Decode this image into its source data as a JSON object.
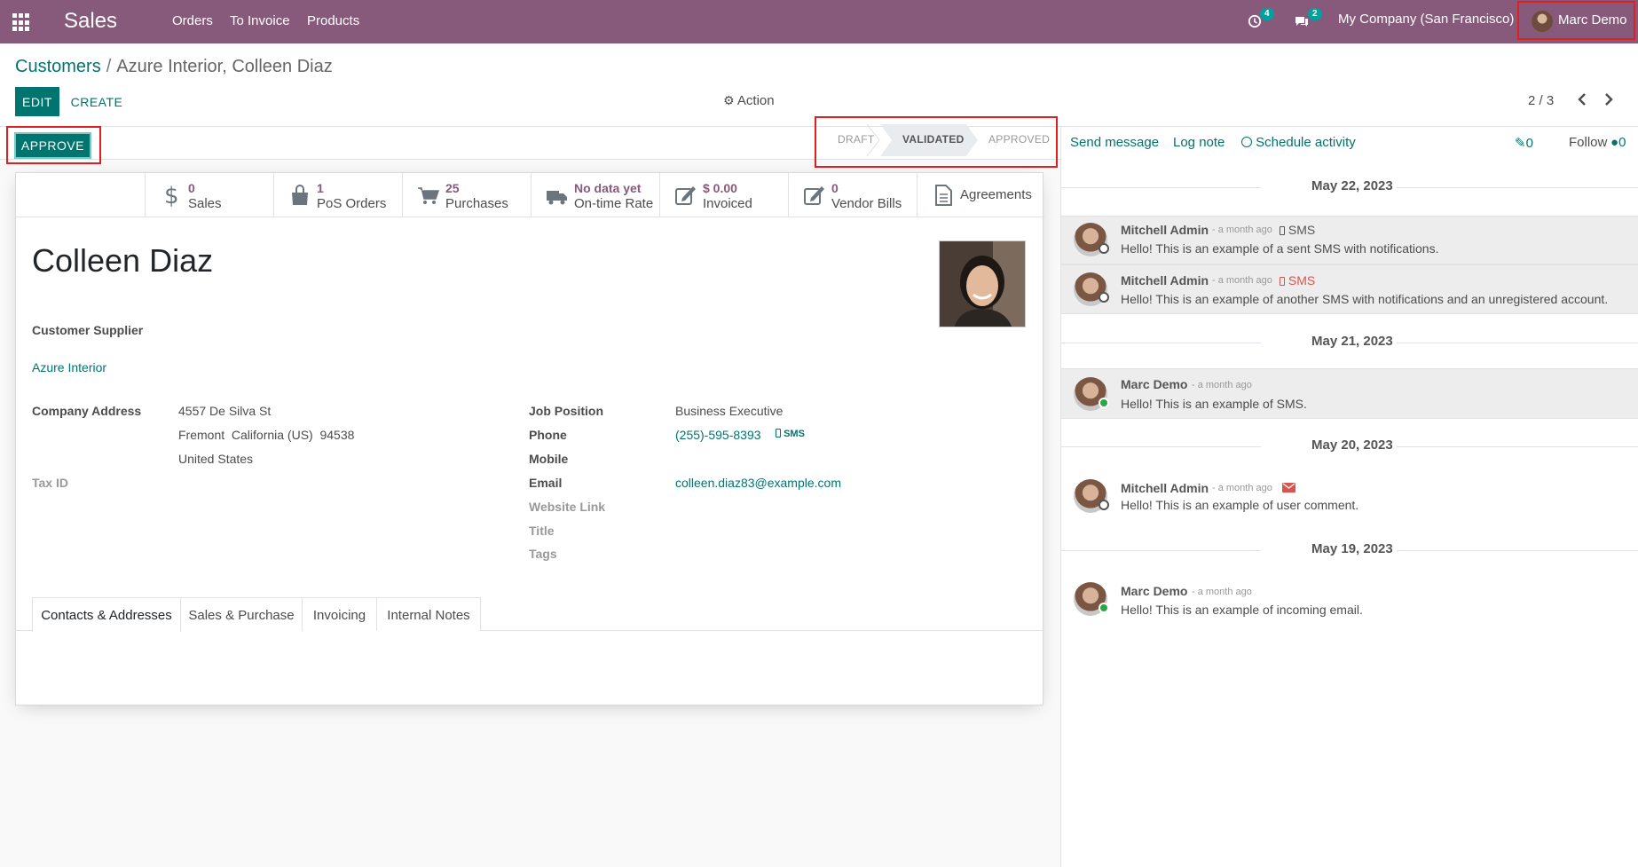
{
  "navbar": {
    "brand": "Sales",
    "menu": [
      "Orders",
      "To Invoice",
      "Products"
    ],
    "activity_count": "4",
    "messages_count": "2",
    "company": "My Company (San Francisco)",
    "user": "Marc Demo"
  },
  "breadcrumb": {
    "parent": "Customers",
    "separator": "/",
    "current": "Azure Interior, Colleen Diaz"
  },
  "toolbar": {
    "edit_label": "EDIT",
    "create_label": "CREATE",
    "action_label": "Action",
    "pager": "2 / 3"
  },
  "statusbar": {
    "approve_label": "APPROVE",
    "stages": [
      "DRAFT",
      "VALIDATED",
      "APPROVED"
    ],
    "current_stage": "VALIDATED"
  },
  "smart_buttons": [
    {
      "value": "",
      "label": "",
      "icon": "blank"
    },
    {
      "value": "0",
      "label": "Sales",
      "icon": "dollar-icon"
    },
    {
      "value": "1",
      "label": "PoS Orders",
      "icon": "shopping-bag-icon"
    },
    {
      "value": "25",
      "label": "Purchases",
      "icon": "cart-icon"
    },
    {
      "value": "No data yet",
      "label": "On-time Rate",
      "icon": "truck-icon"
    },
    {
      "value": "$ 0.00",
      "label": "Invoiced",
      "icon": "edit-icon"
    },
    {
      "value": "0",
      "label": "Vendor Bills",
      "icon": "edit-icon"
    },
    {
      "value": "",
      "label": "Agreements",
      "icon": "document-icon"
    }
  ],
  "partner": {
    "name": "Colleen Diaz",
    "tags_line": "Customer Supplier",
    "company": "Azure Interior",
    "company_address_label": "Company Address",
    "address_street": "4557 De Silva St",
    "address_city": "Fremont  California (US)  94538",
    "address_country": "United States",
    "tax_id_label": "Tax ID",
    "job_position_label": "Job Position",
    "job_position": "Business Executive",
    "phone_label": "Phone",
    "phone": "(255)-595-8393",
    "sms_label": "SMS",
    "mobile_label": "Mobile",
    "email_label": "Email",
    "email": "colleen.diaz83@example.com",
    "website_label": "Website Link",
    "title_label": "Title",
    "tags_label": "Tags"
  },
  "tabs": [
    "Contacts & Addresses",
    "Sales & Purchase",
    "Invoicing",
    "Internal Notes"
  ],
  "chatter": {
    "send_message": "Send message",
    "log_note": "Log note",
    "schedule_activity": "Schedule activity",
    "attachments": "0",
    "follow": "Follow",
    "followers": "0",
    "days": [
      "May 22, 2023",
      "May 21, 2023",
      "May 20, 2023",
      "May 19, 2023"
    ],
    "messages": [
      {
        "author": "Mitchell Admin",
        "date": "- a month ago",
        "type": "SMS",
        "type_color": "#555555",
        "body": "Hello! This is an example of a sent SMS with notifications."
      },
      {
        "author": "Mitchell Admin",
        "date": "- a month ago",
        "type": "SMS",
        "type_color": "#d9534f",
        "body": "Hello! This is an example of another SMS with notifications and an unregistered account."
      },
      {
        "author": "Marc Demo",
        "date": "- a month ago",
        "type": "",
        "type_color": "",
        "body": "Hello! This is an example of SMS."
      },
      {
        "author": "Mitchell Admin",
        "date": "- a month ago",
        "type": "",
        "type_color": "#d9534f",
        "body": "Hello! This is an example of user comment."
      },
      {
        "author": "Marc Demo",
        "date": "- a month ago",
        "type": "",
        "type_color": "",
        "body": "Hello! This is an example of incoming email."
      }
    ]
  },
  "colors": {
    "brand": "#875a7b",
    "primary": "#00746f",
    "online": "#28a745",
    "highlight_box": "#e02020"
  }
}
